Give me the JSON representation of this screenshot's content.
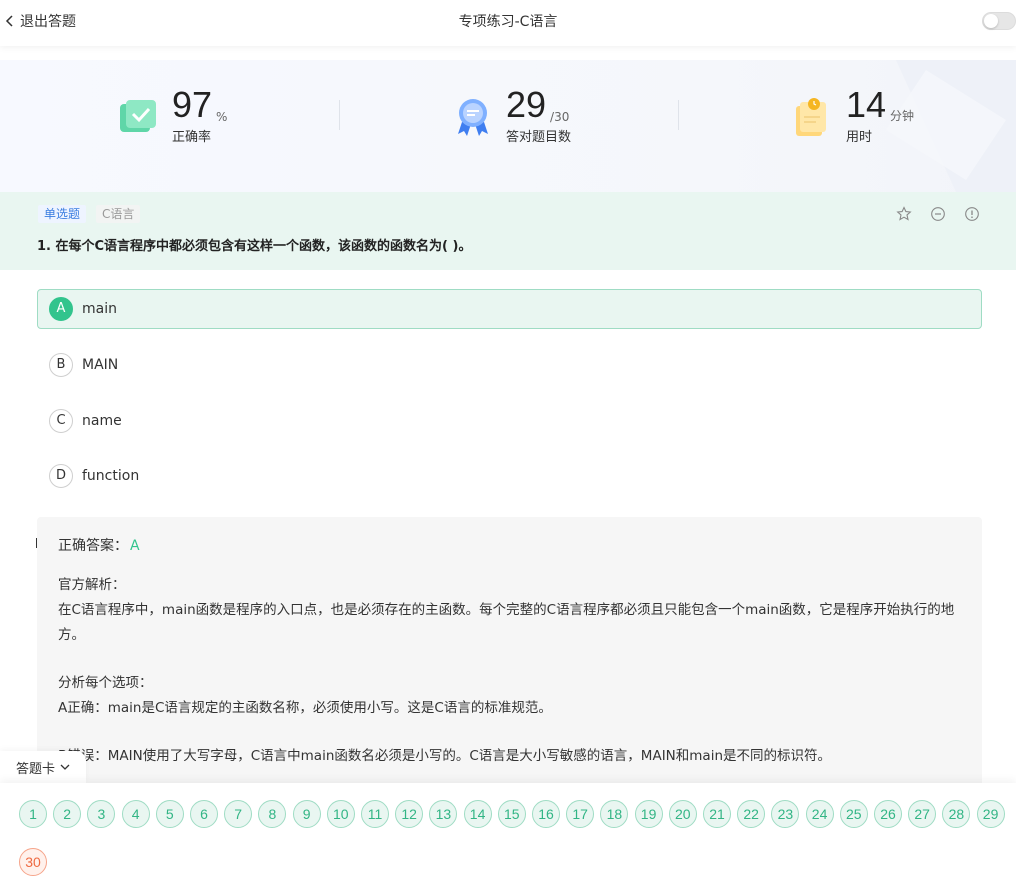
{
  "topbar": {
    "back_label": "退出答题",
    "title": "专项练习-C语言"
  },
  "stats": [
    {
      "value": "97",
      "unit": "%",
      "label": "正确率",
      "icon": "check-card-icon"
    },
    {
      "value": "29",
      "unit": "/30",
      "label": "答对题目数",
      "icon": "ribbon-badge-icon"
    },
    {
      "value": "14",
      "unit": "分钟",
      "label": "用时",
      "icon": "clock-clipboard-icon"
    }
  ],
  "question": {
    "type_tag": "单选题",
    "category_tag": "C语言",
    "text": "1. 在每个C语言程序中都必须包含有这样一个函数，该函数的函数名为( )。",
    "options": [
      {
        "letter": "A",
        "text": "main"
      },
      {
        "letter": "B",
        "text": "MAIN"
      },
      {
        "letter": "C",
        "text": "name"
      },
      {
        "letter": "D",
        "text": "function"
      }
    ],
    "selected": "A"
  },
  "analysis": {
    "correct_label": "正确答案：",
    "correct_value": "A",
    "official_title": "官方解析：",
    "official_text": "在C语言程序中，main函数是程序的入口点，也是必须存在的主函数。每个完整的C语言程序都必须且只能包含一个main函数，它是程序开始执行的地方。",
    "options_title": "分析每个选项：",
    "option_a": "A正确：main是C语言规定的主函数名称，必须使用小写。这是C语言的标准规范。",
    "option_b": "B错误：MAIN使用了大写字母，C语言中main函数名必须是小写的。C语言是大小写敏感的语言，MAIN和main是不同的标识符。"
  },
  "answer_card": {
    "label": "答题卡",
    "numbers": [
      "1",
      "2",
      "3",
      "4",
      "5",
      "6",
      "7",
      "8",
      "9",
      "10",
      "11",
      "12",
      "13",
      "14",
      "15",
      "16",
      "17",
      "18",
      "19",
      "20",
      "21",
      "22",
      "23",
      "24",
      "25",
      "26",
      "27",
      "28",
      "29",
      "30"
    ],
    "wrong": [
      "30"
    ]
  },
  "colors": {
    "accent": "#32c48d",
    "wrong": "#ee6a42",
    "tag_blue": "#3a7de0"
  }
}
